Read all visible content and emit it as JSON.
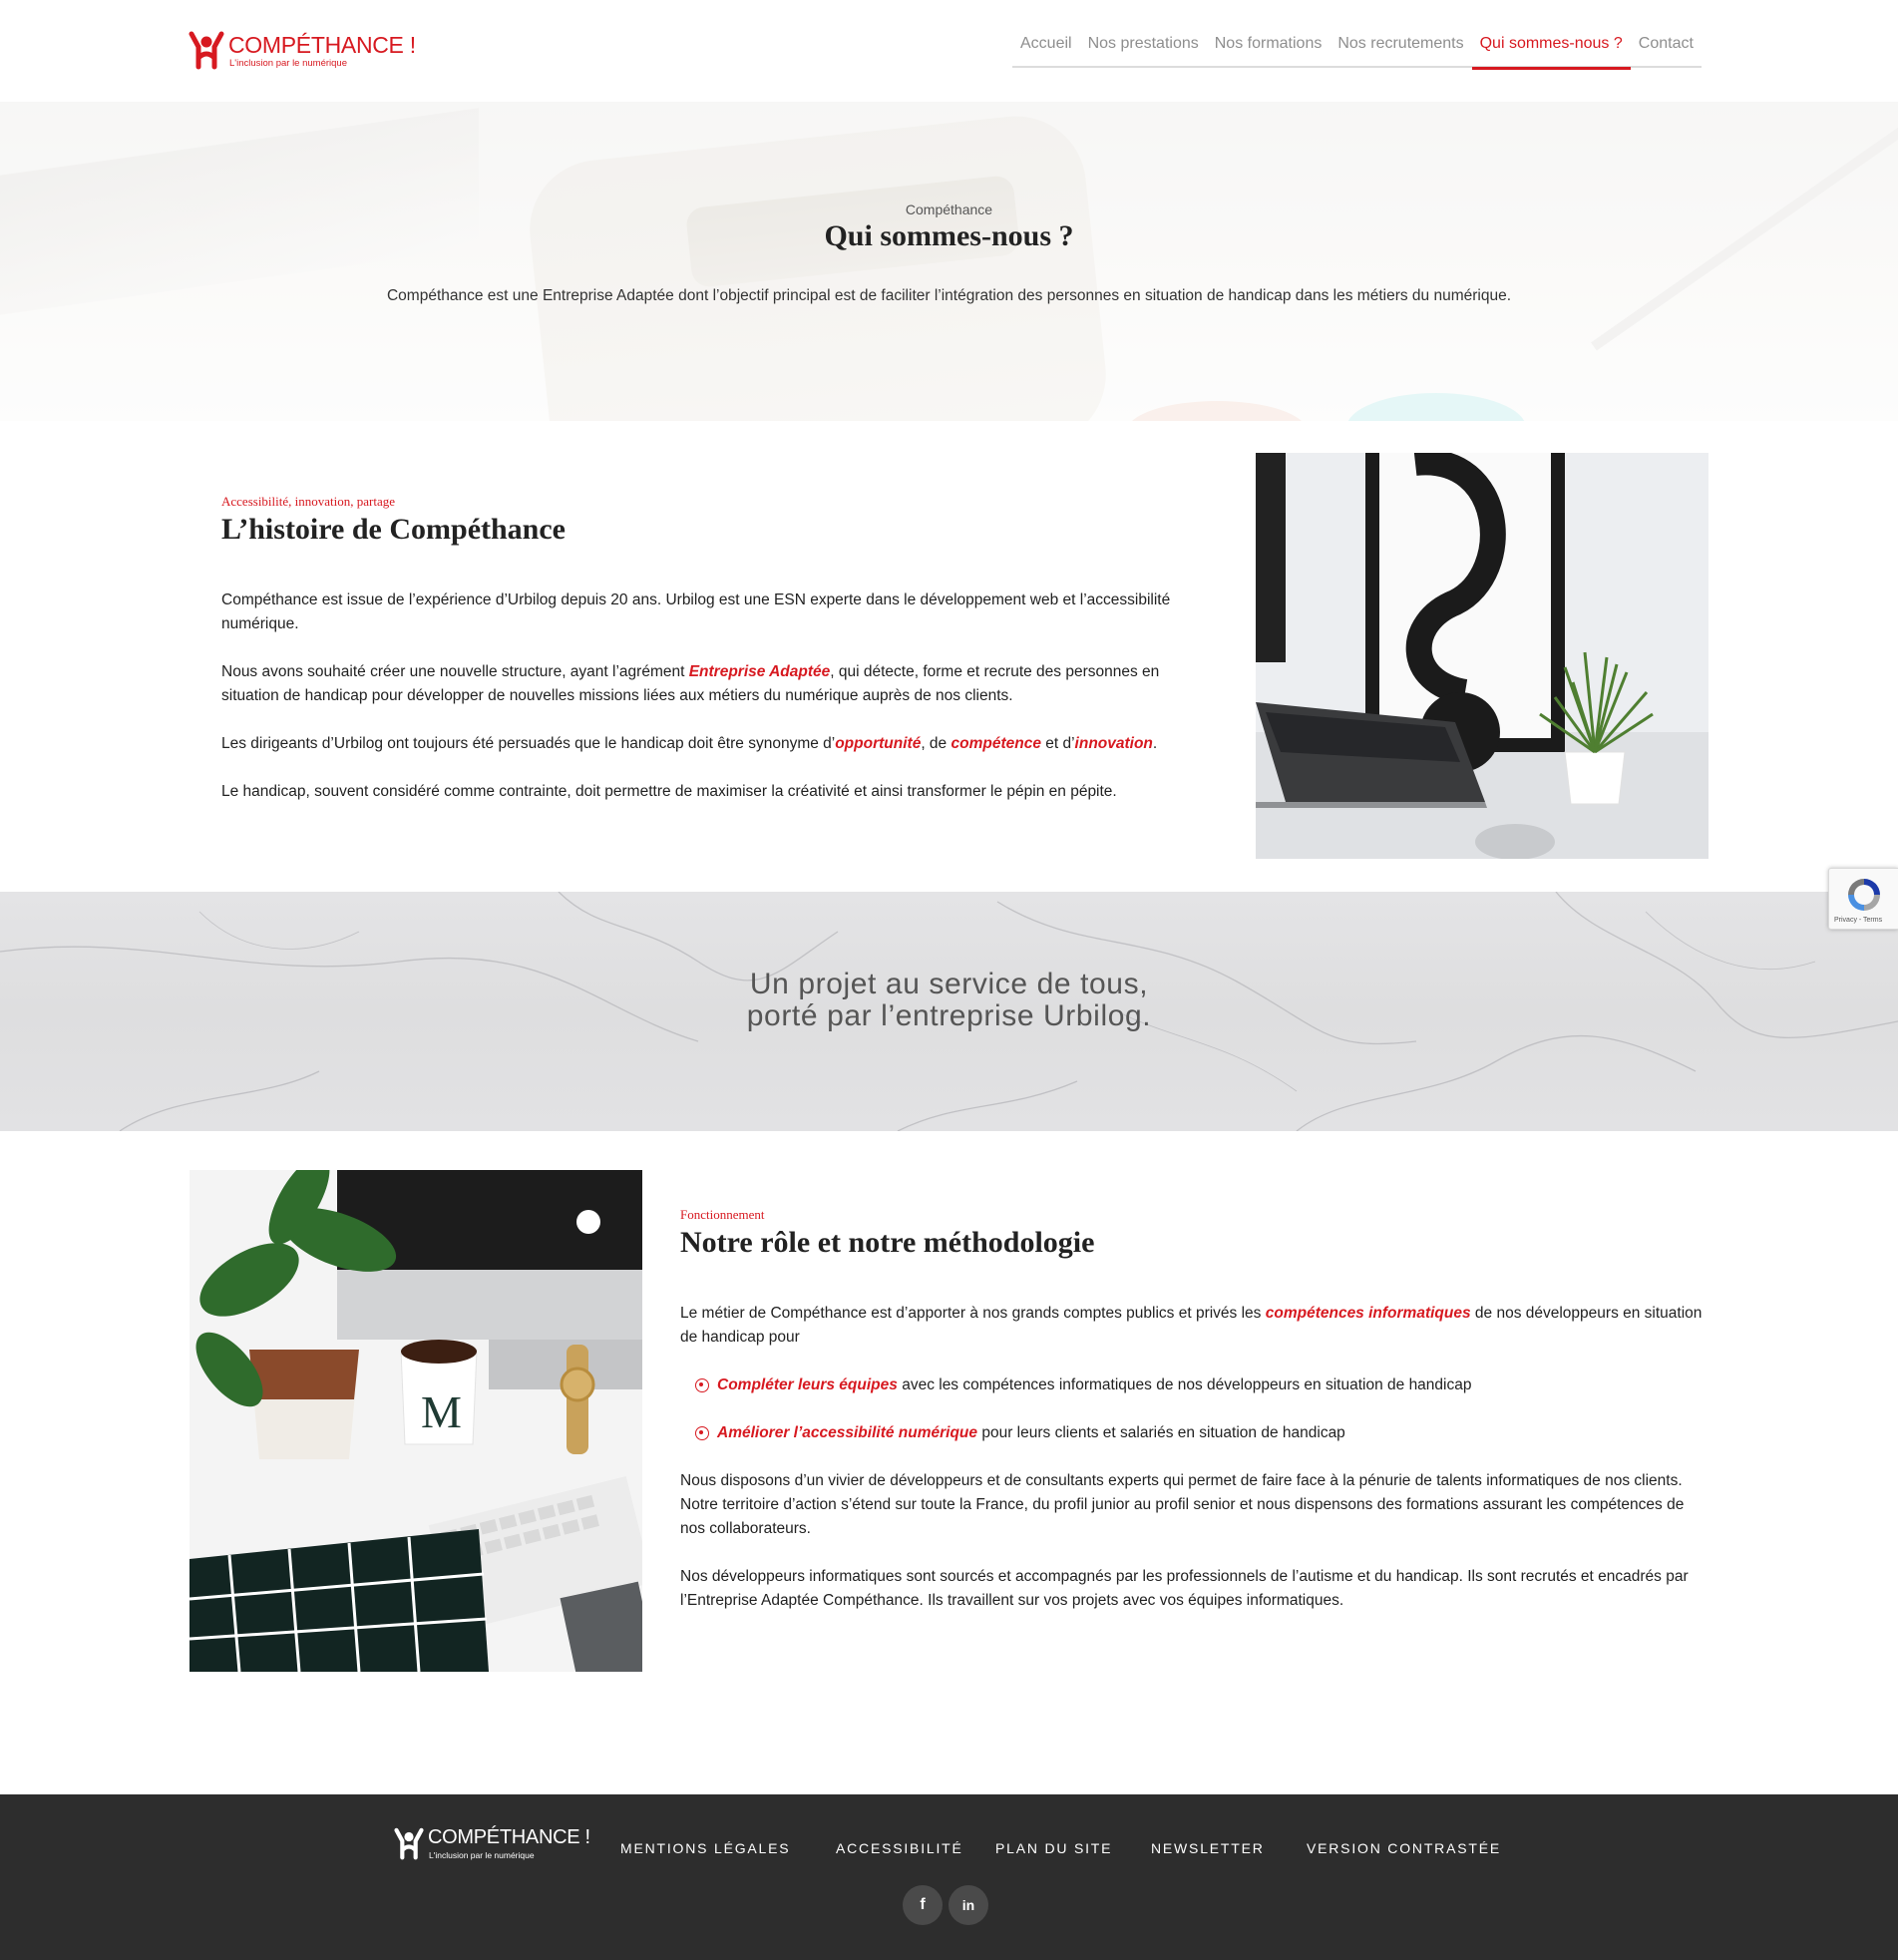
{
  "header": {
    "logo_word": "COMPÉTHANCE !",
    "logo_tagline": "L'inclusion par le numérique",
    "nav": [
      {
        "label": "Accueil"
      },
      {
        "label": "Nos prestations"
      },
      {
        "label": "Nos formations"
      },
      {
        "label": "Nos recrutements"
      },
      {
        "label": "Qui sommes-nous ?"
      },
      {
        "label": "Contact"
      }
    ],
    "active_nav": "Qui sommes-nous ?"
  },
  "hero": {
    "kicker": "Compéthance",
    "title": "Qui sommes-nous ?",
    "text": "Compéthance est une Entreprise Adaptée dont l’objectif principal est de faciliter l’intégration des personnes en situation de handicap dans les métiers du numérique."
  },
  "story": {
    "kicker": "Accessibilité, innovation, partage",
    "title": "L’histoire de Compéthance",
    "p1": "Compéthance est issue de l’expérience d’Urbilog depuis 20 ans. Urbilog est une ESN experte dans le développement web et l’accessibilité numérique.",
    "p2_before": "Nous avons souhaité créer une nouvelle structure, ayant l’agrément ",
    "p2_em": "Entreprise Adaptée",
    "p2_after": ", qui détecte, forme et recrute des personnes en situation de handicap pour développer de nouvelles missions liées aux métiers du numérique auprès de nos clients.",
    "p3_before": "Les dirigeants d’Urbilog ont toujours été persuadés que le handicap doit être synonyme d’",
    "p3_em1": "opportunité",
    "p3_mid1": ", de ",
    "p3_em2": "compétence",
    "p3_mid2": " et d’",
    "p3_em3": "innovation",
    "p3_after": ".",
    "p4": "Le handicap, souvent considéré comme contrainte, doit permettre de maximiser la créativité et ainsi transformer le pépin en pépite."
  },
  "banner": {
    "line1": "Un projet au service de tous,",
    "line2": "porté par l’entreprise Urbilog."
  },
  "method": {
    "kicker": "Fonctionnement",
    "title": "Notre rôle et notre méthodologie",
    "p1_before": "Le métier de Compéthance est d’apporter à nos grands comptes publics et privés les ",
    "p1_em": "compétences informatiques",
    "p1_after": " de nos développeurs en situation de handicap pour",
    "bullet1_em": "Compléter leurs équipes",
    "bullet1_text": " avec les compétences informatiques de nos développeurs en situation de handicap",
    "bullet2_em": "Améliorer l’accessibilité numérique",
    "bullet2_text": " pour leurs clients et salariés en situation de handicap",
    "p2": "Nous disposons d’un vivier de développeurs et de consultants experts qui permet de faire face à la pénurie de talents informatiques de nos clients. Notre territoire d’action s’étend sur toute la France, du profil junior au profil senior et nous dispensons des formations assurant les compétences de nos collaborateurs.",
    "p3": "Nos développeurs informatiques sont sourcés et accompagnés par les professionnels de l’autisme et du handicap. Ils sont recrutés et encadrés par l’Entreprise Adaptée Compéthance. Ils travaillent sur vos projets avec vos équipes informatiques."
  },
  "recaptcha": {
    "terms": "Privacy - Terms"
  },
  "footer": {
    "logo_word": "COMPÉTHANCE !",
    "logo_tagline": "L'inclusion par le numérique",
    "links": [
      {
        "label": "MENTIONS LÉGALES"
      },
      {
        "label": "ACCESSIBILITÉ"
      },
      {
        "label": "PLAN DU SITE"
      },
      {
        "label": "NEWSLETTER"
      },
      {
        "label": "VERSION CONTRASTÉE"
      }
    ],
    "social": [
      {
        "icon": "facebook-icon",
        "glyph": "f"
      },
      {
        "icon": "linkedin-icon",
        "glyph": "in"
      }
    ]
  },
  "colors": {
    "accent": "#d71920",
    "nav_text": "#8e8e8e",
    "footer_bg": "#2d2d2d"
  }
}
